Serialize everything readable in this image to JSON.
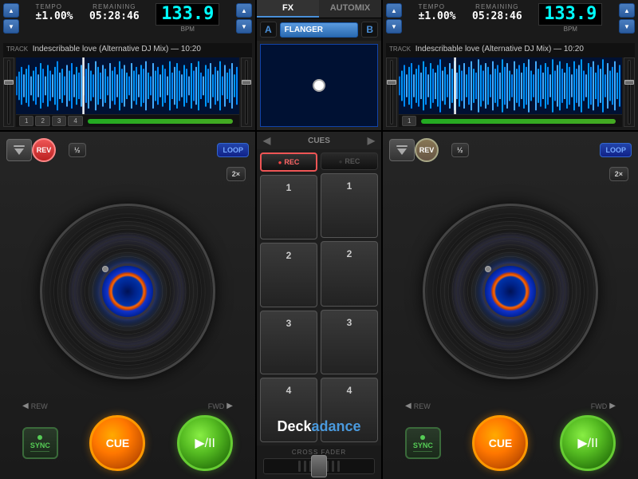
{
  "app": {
    "title": "Deckadance",
    "brand_main": "Deck",
    "brand_sub": "adance"
  },
  "header": {
    "fx_tab": "FX",
    "automix_tab": "AUTOMIX",
    "fx_effect": "FLANGER"
  },
  "deck_left": {
    "tempo_label": "TEMPO",
    "tempo_value": "±1.00%",
    "remaining_label": "REMAINING",
    "remaining_value": "05:28:46",
    "bpm_value": "133.9",
    "bpm_unit": "BPM",
    "track_label": "TRACK",
    "track_name": "Indescribable love (Alternative DJ Mix) — 10:20",
    "rev_label": "REV",
    "half_label": "½",
    "loop_label": "LOOP",
    "x2_label": "2×",
    "rew_label": "REW",
    "fwd_label": "FWD",
    "sync_label": "SYNC",
    "cue_label": "CUE",
    "play_label": "▶/II",
    "cue_markers": [
      "1",
      "2",
      "3",
      "4"
    ],
    "tempo_area_label": "TEMPO"
  },
  "deck_right": {
    "tempo_label": "TEMPO",
    "tempo_value": "±1.00%",
    "remaining_label": "REMAINING",
    "remaining_value": "05:28:46",
    "bpm_value": "133.9",
    "bpm_unit": "BPM",
    "track_label": "TRACK",
    "track_name": "Indescribable love (Alternative DJ Mix) — 10:20",
    "rev_label": "REV",
    "half_label": "½",
    "loop_label": "LOOP",
    "x2_label": "2×",
    "rew_label": "REW",
    "fwd_label": "FWD",
    "sync_label": "SYNC",
    "cue_label": "CUE",
    "play_label": "▶/II",
    "cue_markers": [
      "1"
    ],
    "tempo_area_label": "TEMPO"
  },
  "center": {
    "cues_label": "CUES",
    "rec_left_label": "● REC",
    "rec_right_label": "● REC",
    "cue_nums": [
      "1",
      "2",
      "3",
      "4"
    ],
    "cross_fader_label": "CROSS FADER"
  },
  "fx_deck_a": "A",
  "fx_deck_b": "B"
}
